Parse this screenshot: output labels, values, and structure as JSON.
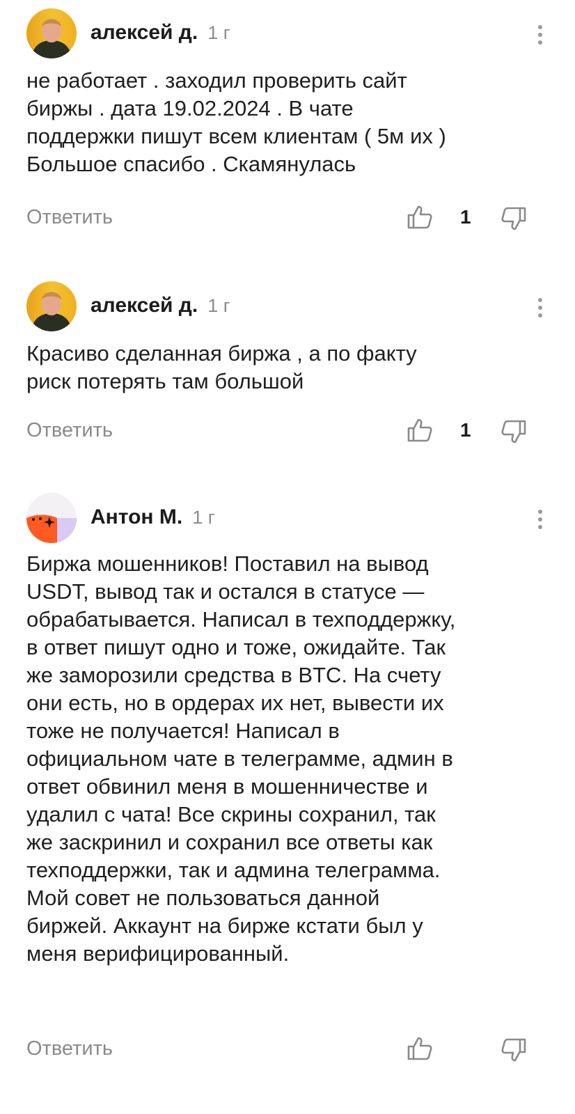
{
  "comments": [
    {
      "author": "алексей д.",
      "age": "1 г",
      "avatar": "photo-avatar",
      "lines": [
        "не работает . заходил проверить сайт",
        "биржы . дата 19.02.2024 . В чате",
        "поддержки пишут всем клиентам ( 5м их )",
        "Большое спасибо . Скамянулась"
      ],
      "reply_label": "Ответить",
      "likes": "1"
    },
    {
      "author": "алексей д.",
      "age": "1 г",
      "avatar": "photo-avatar",
      "lines": [
        "Красиво сделанная биржа , а по факту",
        "риск потерять там большой"
      ],
      "reply_label": "Ответить",
      "likes": "1"
    },
    {
      "author": "Антон М.",
      "age": "1 г",
      "avatar": "generated-avatar",
      "lines": [
        "Биржа мошенников! Поставил на вывод",
        "USDT, вывод так и остался в статусе —",
        "обрабатывается. Написал в техподдержку,",
        "в ответ пишут одно и тоже, ожидайте. Так",
        "же заморозили средства в BTC. На счету",
        "они есть, но в ордерах их нет, вывести их",
        "тоже не получается! Написал в",
        "официальном чате в телеграмме, админ в",
        "ответ обвинил меня в мошенничестве и",
        "удалил с чата! Все скрины сохранил, так",
        "же заскринил и сохранил все ответы как",
        "техподдержки, так и админа телеграмма.",
        "Мой совет не пользоваться данной",
        "биржей. Аккаунт на бирже кстати был у",
        "меня верифицированный."
      ],
      "reply_label": "Ответить",
      "likes": ""
    }
  ],
  "colors": {
    "text": "#1f1f1f",
    "muted": "#8a8a8a",
    "avatar_orange": "#ff5a1f",
    "avatar_lavender": "#d9c9f5"
  },
  "icons": [
    "more-vertical-icon",
    "thumbs-up-icon",
    "thumbs-down-icon"
  ]
}
